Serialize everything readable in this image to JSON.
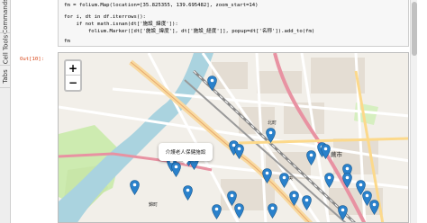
{
  "sidebar": {
    "tabs": [
      {
        "label": "Commands"
      },
      {
        "label": "Cell Tools"
      },
      {
        "label": "Tabs"
      }
    ]
  },
  "code": {
    "line1": "fm = folium.Map(location=[35.825355, 139.695482], zoom_start=14)",
    "line2": "for i, dt in df.iterrows():",
    "line3": "    if not math.isnan(dt['施設_緯度']):",
    "line4": "        folium.Marker([dt['施設_緯度'], dt['施設_経度']], popup=dt['名称']).add_to(fm)",
    "line5": "fm"
  },
  "output": {
    "prompt": "Out[10]:"
  },
  "map": {
    "zoom_in": "+",
    "zoom_out": "−",
    "popup_text": "介護老人保健施設",
    "labels": {
      "station": "蕨市",
      "area_north": "北町",
      "area_east": "錦町",
      "area_south": "中央"
    },
    "marker_color": "#2a81cb"
  }
}
